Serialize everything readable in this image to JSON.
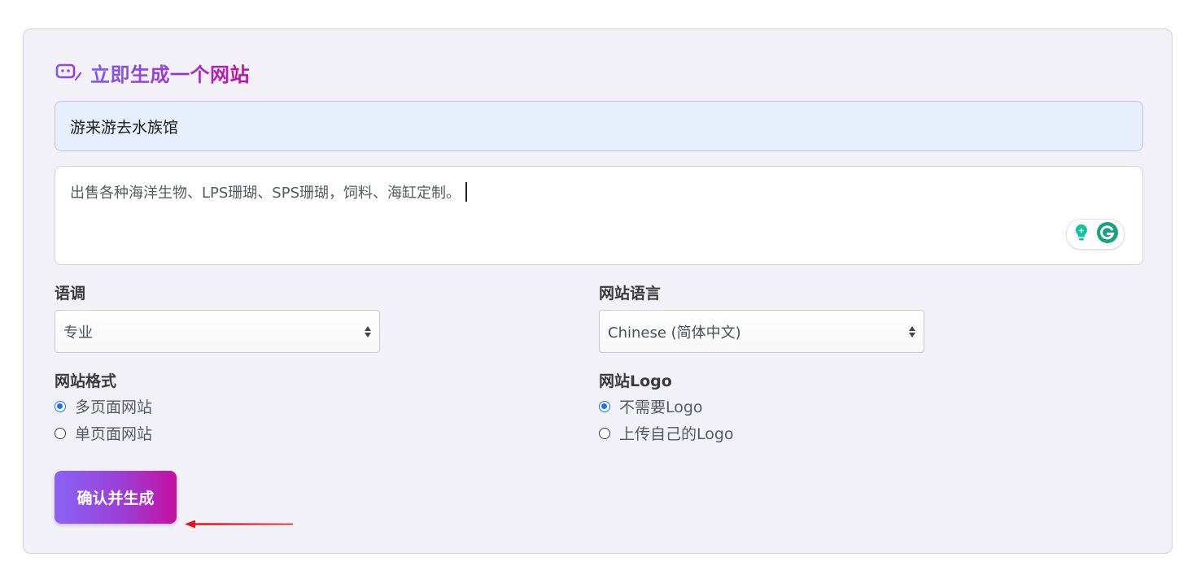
{
  "form": {
    "title": "立即生成一个网站",
    "site_name_value": "游来游去水族馆",
    "description_value": "出售各种海洋生物、LPS珊瑚、SPS珊瑚，饲料、海缸定制。",
    "tone": {
      "label": "语调",
      "selected": "专业"
    },
    "language": {
      "label": "网站语言",
      "selected": "Chinese (简体中文)"
    },
    "format": {
      "label": "网站格式",
      "options": [
        {
          "label": "多页面网站",
          "checked": true
        },
        {
          "label": "单页面网站",
          "checked": false
        }
      ]
    },
    "logo": {
      "label": "网站Logo",
      "options": [
        {
          "label": "不需要Logo",
          "checked": true
        },
        {
          "label": "上传自己的Logo",
          "checked": false
        }
      ]
    },
    "submit_label": "确认并生成"
  },
  "icons": {
    "title_icon": "robot-icon",
    "grammarly_assist": "lightbulb-icon",
    "grammarly_logo": "grammarly-icon",
    "annotation": "red-arrow-icon"
  },
  "colors": {
    "accent_start": "#8a63f5",
    "accent_end": "#c4109f",
    "radio_checked": "#1a73e8",
    "annotation_arrow": "#e3141b",
    "grammarly_green": "#15c39a"
  }
}
